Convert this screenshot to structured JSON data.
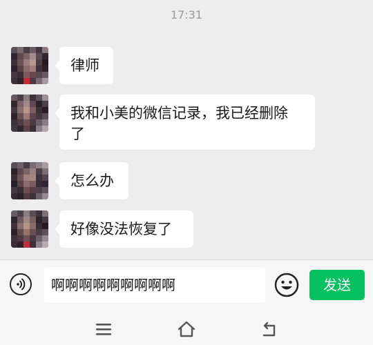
{
  "status": {
    "timestamp": "17:31"
  },
  "messages": [
    {
      "sender": "contact",
      "text": "律师"
    },
    {
      "sender": "contact",
      "text": "我和小美的微信记录，我已经删除了"
    },
    {
      "sender": "contact",
      "text": "怎么办"
    },
    {
      "sender": "contact",
      "text": "好像没法恢复了"
    }
  ],
  "composer": {
    "input_value": "啊啊啊啊啊啊啊啊啊",
    "send_label": "发送",
    "voice_icon": "voice-icon",
    "emoji_icon": "emoji-icon"
  },
  "nav": {
    "menu_icon": "menu-icon",
    "home_icon": "home-icon",
    "back_icon": "back-icon"
  },
  "colors": {
    "background": "#ededed",
    "bubble": "#ffffff",
    "send_button": "#07c160"
  }
}
